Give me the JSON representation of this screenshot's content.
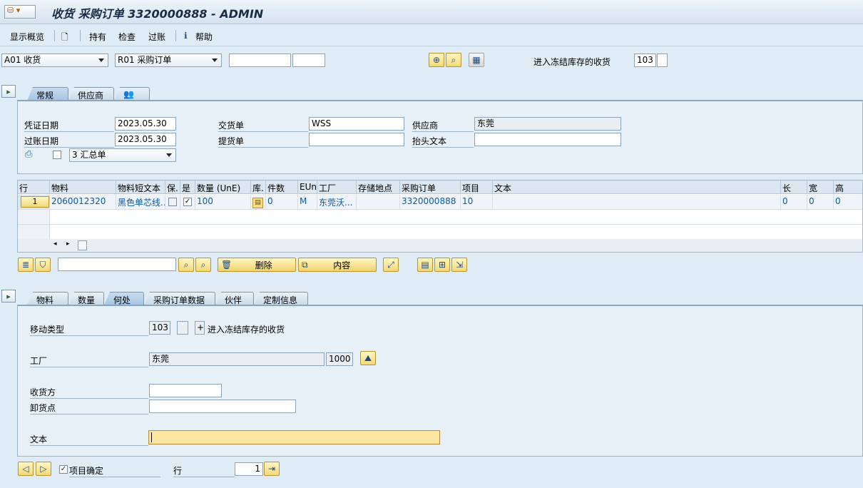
{
  "title": "收货 采购订单 3320000888 - ADMIN",
  "toolbar": {
    "overview": "显示概览",
    "hold": "持有",
    "check": "检查",
    "post": "过账",
    "help": "帮助"
  },
  "header": {
    "action": "A01 收货",
    "ref_doc": "R01 采购订单",
    "po_no": "",
    "po_item": "",
    "movement_text": "进入冻结库存的收货",
    "movement_type": "103",
    "movement_ind": ""
  },
  "tabs_top": [
    {
      "label": "常规"
    },
    {
      "label": "供应商"
    },
    {
      "label": ""
    }
  ],
  "general": {
    "doc_date_label": "凭证日期",
    "doc_date": "2023.05.30",
    "post_date_label": "过账日期",
    "post_date": "2023.05.30",
    "delivery_label": "交货单",
    "delivery": "WSS",
    "bill_label": "提货单",
    "bill": "",
    "vendor_label": "供应商",
    "vendor": "东莞",
    "header_text_label": "抬头文本",
    "header_text": "",
    "slip": "3 汇总单"
  },
  "grid": {
    "headers": [
      "行",
      "物料",
      "物料短文本",
      "保.",
      "是",
      "数量 (UnE)",
      "库.",
      "件数",
      "EUn",
      "工厂",
      "存储地点",
      "采购订单",
      "项目",
      "文本",
      "长",
      "宽",
      "高"
    ],
    "rows": [
      {
        "line": "1",
        "material": "2060012320",
        "short_text": "黑色单芯线...",
        "qty": "100",
        "pieces": "0",
        "eun": "M",
        "plant": "东莞沃...",
        "sloc": "",
        "po": "3320000888",
        "item": "10",
        "text": "",
        "l": "0",
        "w": "0",
        "h": "0"
      }
    ]
  },
  "buttons": {
    "delete": "删除",
    "content": "内容",
    "search": ""
  },
  "tabs_bottom": [
    {
      "label": "物料"
    },
    {
      "label": "数量"
    },
    {
      "label": "何处"
    },
    {
      "label": "采购订单数据"
    },
    {
      "label": "伙伴"
    },
    {
      "label": "定制信息"
    }
  ],
  "where": {
    "mvt_label": "移动类型",
    "mvt": "103",
    "mvt_ind": "",
    "mvt_sign": "+",
    "mvt_text": "进入冻结库存的收货",
    "plant_label": "工厂",
    "plant_name": "东莞",
    "plant_code": "1000",
    "recipient_label": "收货方",
    "recipient": "",
    "unload_label": "卸货点",
    "unload": "",
    "text_label": "文本",
    "text": ""
  },
  "footer": {
    "item_ok": "项目确定",
    "line_label": "行",
    "line": "1"
  }
}
